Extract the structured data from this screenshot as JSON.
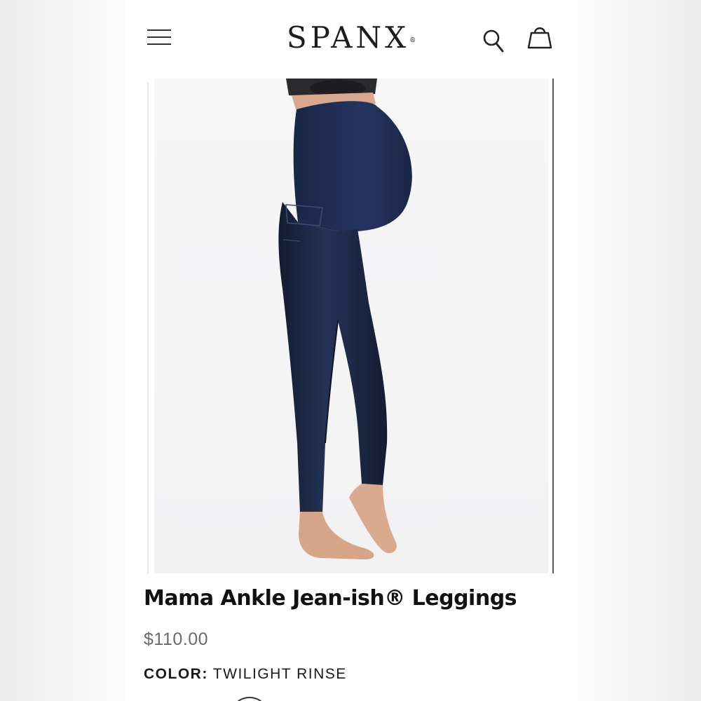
{
  "header": {
    "brand": "SPANX",
    "brand_mark": "®",
    "icons": [
      "menu-icon",
      "search-icon",
      "shopping-bag-icon"
    ]
  },
  "gallery": {
    "image": "product-photo"
  },
  "product": {
    "title": "Mama Ankle Jean-ish® Leggings",
    "price": "$110.00",
    "color_label": "COLOR:",
    "color_value": "TWILIGHT RINSE"
  },
  "colors": {
    "denim": "#1c2740",
    "waistband": "#1e2c4f",
    "skin": "#d9a98c",
    "text": "#111111",
    "price": "#6b6b6b"
  }
}
